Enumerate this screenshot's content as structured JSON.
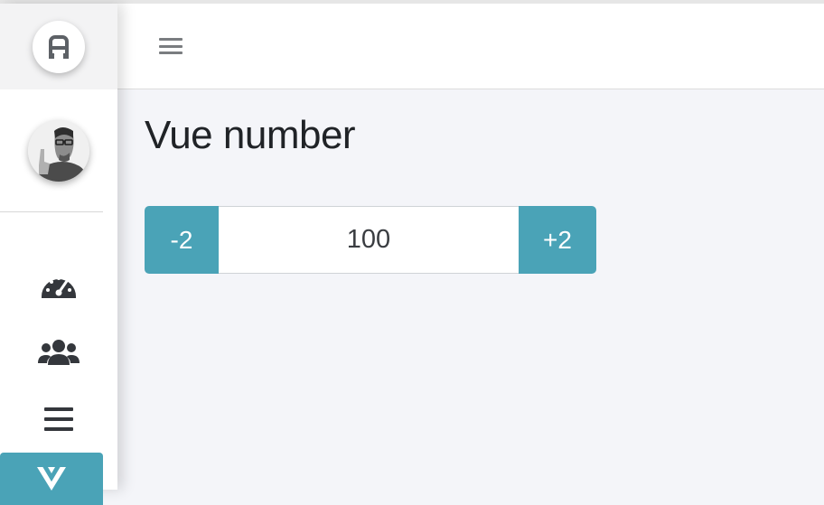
{
  "header": {
    "menu_icon": "hamburger-icon"
  },
  "sidebar": {
    "brand_icon": "brand-logo-icon",
    "items": [
      {
        "icon": "dashboard-gauge-icon"
      },
      {
        "icon": "users-icon"
      },
      {
        "icon": "list-icon"
      },
      {
        "icon": "vue-logo-icon",
        "active": true
      }
    ],
    "accent_color": "#4aa3b7"
  },
  "main": {
    "title": "Vue number",
    "stepper": {
      "decrement_label": "-2",
      "value": "100",
      "increment_label": "+2"
    }
  }
}
